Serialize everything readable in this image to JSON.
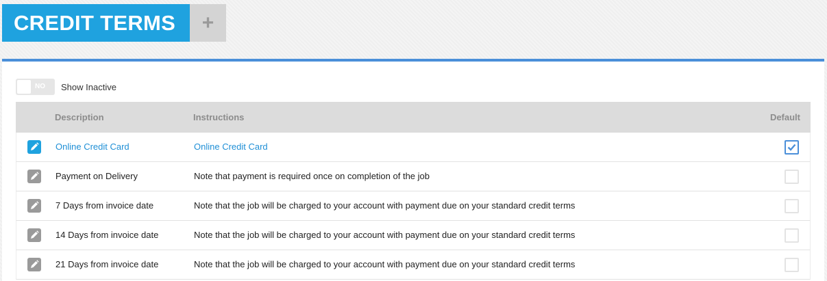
{
  "header": {
    "title": "CREDIT TERMS",
    "add_label": "+"
  },
  "filter": {
    "toggle_state": "NO",
    "toggle_label": "Show Inactive"
  },
  "table": {
    "columns": {
      "description": "Description",
      "instructions": "Instructions",
      "default": "Default"
    },
    "rows": [
      {
        "description": "Online Credit Card",
        "instructions": "Online Credit Card",
        "default": true
      },
      {
        "description": "Payment on Delivery",
        "instructions": "Note that payment is required once on completion of the job",
        "default": false
      },
      {
        "description": "7 Days from invoice date",
        "instructions": "Note that the job will be charged to your account with payment due on your standard credit terms",
        "default": false
      },
      {
        "description": "14 Days from invoice date",
        "instructions": "Note that the job will be charged to your account with payment due on your standard credit terms",
        "default": false
      },
      {
        "description": "21 Days from invoice date",
        "instructions": "Note that the job will be charged to your account with payment due on your standard credit terms",
        "default": false
      }
    ]
  },
  "colors": {
    "accent": "#1fa2df",
    "panel_border": "#4a8fd9",
    "header_bg": "#dcdcdc",
    "edit_inactive": "#9a9a9a"
  },
  "icons": {
    "edit": "pencil-icon",
    "default_checked": "checkmark-icon"
  }
}
